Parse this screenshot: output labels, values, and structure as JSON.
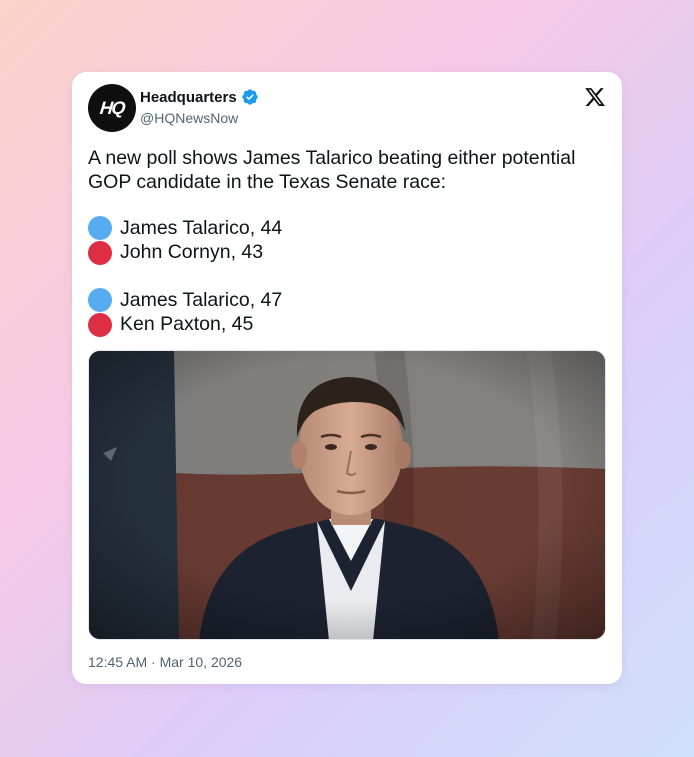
{
  "account": {
    "avatar_text": "HQ",
    "display_name": "Headquarters",
    "handle": "@HQNewsNow",
    "verified": true
  },
  "tweet": {
    "text_line_1": "A new poll shows James Talarico beating either potential",
    "text_line_2": "GOP candidate in the Texas Senate race:",
    "polls": [
      [
        {
          "label": "James Talarico, 44",
          "color": "#55acee"
        },
        {
          "label": "John Cornyn, 43",
          "color": "#dd2e44"
        }
      ],
      [
        {
          "label": "James Talarico, 47",
          "color": "#55acee"
        },
        {
          "label": "Ken Paxton, 45",
          "color": "#dd2e44"
        }
      ]
    ],
    "timestamp": "12:45 AM · Mar 10, 2026"
  },
  "colors": {
    "blue_dot": "#55acee",
    "red_dot": "#dd2e44",
    "verified_badge": "#1d9bf0"
  },
  "icons": {
    "platform": "x-logo-icon",
    "badge": "verified-badge-icon"
  }
}
